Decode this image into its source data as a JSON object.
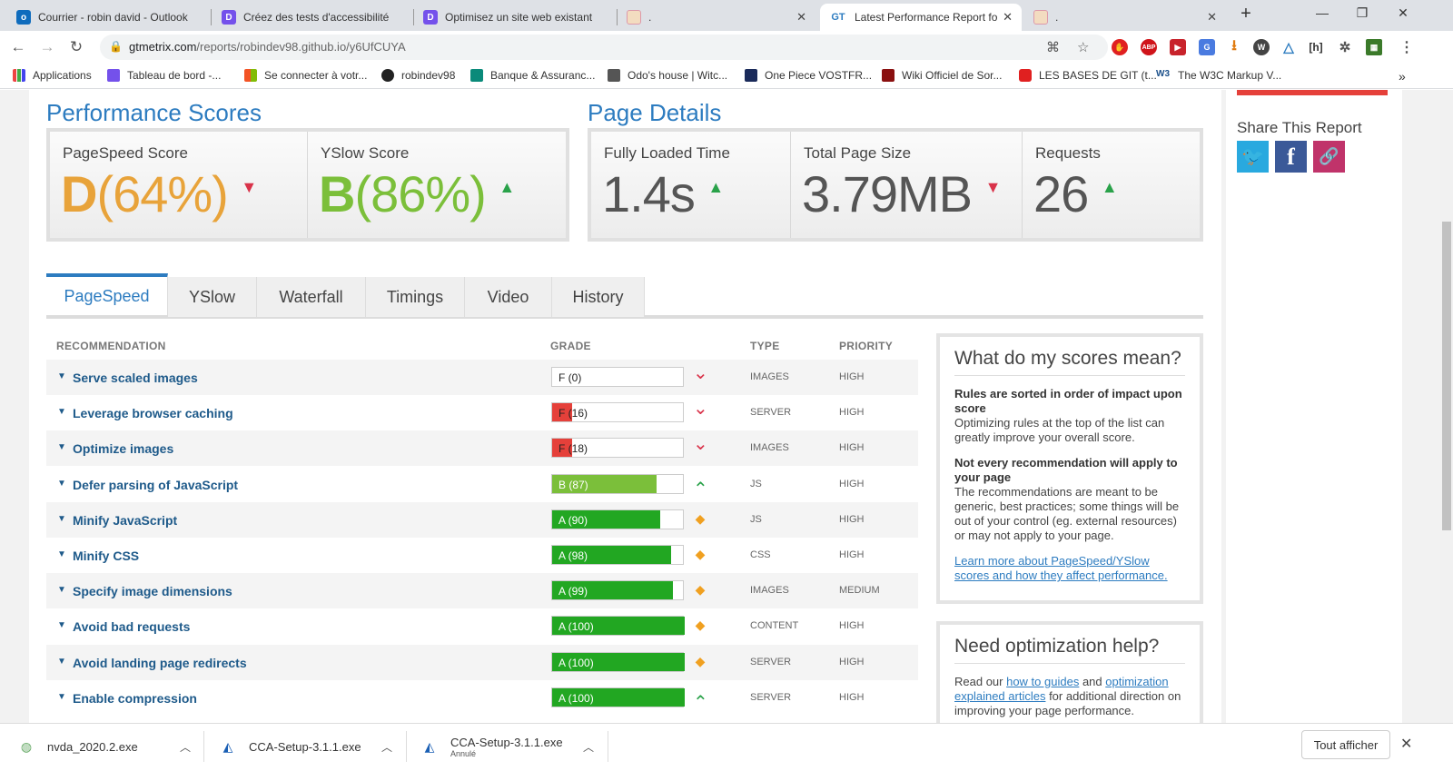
{
  "browser": {
    "tabs": [
      {
        "title": "Courrier - robin david - Outlook",
        "icon": "outlook-icon",
        "color": "#0f6cbd",
        "glyph": "o"
      },
      {
        "title": "Créez des tests d'accessibilité",
        "icon": "openclassrooms-icon",
        "color": "#7451eb",
        "glyph": "D"
      },
      {
        "title": "Optimisez un site web existant",
        "icon": "openclassrooms-icon",
        "color": "#7451eb",
        "glyph": "D"
      },
      {
        "title": ".",
        "icon": "blank-page-icon",
        "color": "#e8c9a0",
        "glyph": ""
      },
      {
        "title": "Latest Performance Report for",
        "icon": "gtmetrix-icon",
        "color": "#ffffff",
        "glyph": "GT"
      },
      {
        "title": ".",
        "icon": "blank-page-icon",
        "color": "#e8c9a0",
        "glyph": ""
      }
    ],
    "url_host": "gtmetrix.com",
    "url_path": "/reports/robindev98.github.io/y6UfCUYA",
    "bookmarks": [
      {
        "label": "Applications",
        "icon": "apps-grid-icon"
      },
      {
        "label": "Tableau de bord -...",
        "icon": "openclassrooms-icon"
      },
      {
        "label": "Se connecter à votr...",
        "icon": "microsoft-icon"
      },
      {
        "label": "robindev98",
        "icon": "github-icon"
      },
      {
        "label": "Banque & Assuranc...",
        "icon": "credit-agricole-icon"
      },
      {
        "label": "Odo's house | Witc...",
        "icon": "witcher-icon"
      },
      {
        "label": "One Piece VOSTFR...",
        "icon": "onepiece-icon"
      },
      {
        "label": "Wiki Officiel de Sor...",
        "icon": "wiki-icon"
      },
      {
        "label": "LES BASES DE GIT (t...",
        "icon": "youtube-icon"
      },
      {
        "label": "The W3C Markup V...",
        "icon": "w3c-icon"
      }
    ],
    "more_bookmarks": "»"
  },
  "performance": {
    "heading": "Performance Scores",
    "pagespeed": {
      "label": "PageSpeed Score",
      "grade": "D",
      "percent": "(64%)",
      "trend": "down",
      "color": "#e8a33a"
    },
    "yslow": {
      "label": "YSlow Score",
      "grade": "B",
      "percent": "(86%)",
      "trend": "up",
      "color": "#7bbf3a"
    }
  },
  "details": {
    "heading": "Page Details",
    "loaded": {
      "label": "Fully Loaded Time",
      "value": "1.4s",
      "trend": "up"
    },
    "size": {
      "label": "Total Page Size",
      "value": "3.79MB",
      "trend": "down"
    },
    "requests": {
      "label": "Requests",
      "value": "26",
      "trend": "up"
    }
  },
  "share": {
    "title": "Share This Report"
  },
  "tabs": [
    "PageSpeed",
    "YSlow",
    "Waterfall",
    "Timings",
    "Video",
    "History"
  ],
  "table": {
    "headers": {
      "recommendation": "RECOMMENDATION",
      "grade": "GRADE",
      "type": "TYPE",
      "priority": "PRIORITY"
    },
    "rows": [
      {
        "name": "Serve scaled images",
        "grade": "F (0)",
        "score": 0,
        "color": "#e5403a",
        "trend": "down",
        "type": "IMAGES",
        "priority": "HIGH"
      },
      {
        "name": "Leverage browser caching",
        "grade": "F (16)",
        "score": 16,
        "color": "#e5403a",
        "trend": "down",
        "type": "SERVER",
        "priority": "HIGH"
      },
      {
        "name": "Optimize images",
        "grade": "F (18)",
        "score": 18,
        "color": "#e5403a",
        "trend": "down",
        "type": "IMAGES",
        "priority": "HIGH"
      },
      {
        "name": "Defer parsing of JavaScript",
        "grade": "B (87)",
        "score": 87,
        "color": "#7bbf3a",
        "trend": "up",
        "type": "JS",
        "priority": "HIGH"
      },
      {
        "name": "Minify JavaScript",
        "grade": "A (90)",
        "score": 90,
        "color": "#22a722",
        "trend": "same",
        "type": "JS",
        "priority": "HIGH"
      },
      {
        "name": "Minify CSS",
        "grade": "A (98)",
        "score": 98,
        "color": "#22a722",
        "trend": "same",
        "type": "CSS",
        "priority": "HIGH"
      },
      {
        "name": "Specify image dimensions",
        "grade": "A (99)",
        "score": 99,
        "color": "#22a722",
        "trend": "same",
        "type": "IMAGES",
        "priority": "MEDIUM"
      },
      {
        "name": "Avoid bad requests",
        "grade": "A (100)",
        "score": 100,
        "color": "#22a722",
        "trend": "same",
        "type": "CONTENT",
        "priority": "HIGH"
      },
      {
        "name": "Avoid landing page redirects",
        "grade": "A (100)",
        "score": 100,
        "color": "#22a722",
        "trend": "same",
        "type": "SERVER",
        "priority": "HIGH"
      },
      {
        "name": "Enable compression",
        "grade": "A (100)",
        "score": 100,
        "color": "#22a722",
        "trend": "up",
        "type": "SERVER",
        "priority": "HIGH"
      }
    ]
  },
  "scores_box": {
    "title": "What do my scores mean?",
    "b1": "Rules are sorted in order of impact upon score",
    "p1": "Optimizing rules at the top of the list can greatly improve your overall score.",
    "b2": "Not every recommendation will apply to your page",
    "p2": "The recommendations are meant to be generic, best practices; some things will be out of your control (eg. external resources) or may not apply to your page.",
    "link": "Learn more about PageSpeed/YSlow scores and how they affect performance."
  },
  "help_box": {
    "title": "Need optimization help?",
    "t1": "Read our ",
    "l1": "how to guides",
    "t2": " and ",
    "l2": "optimization explained articles",
    "t3": " for additional direction on improving your page performance."
  },
  "downloads": {
    "items": [
      {
        "name": "nvda_2020.2.exe",
        "sub": ""
      },
      {
        "name": "CCA-Setup-3.1.1.exe",
        "sub": ""
      },
      {
        "name": "CCA-Setup-3.1.1.exe",
        "sub": "Annulé"
      }
    ],
    "show_all": "Tout afficher"
  }
}
